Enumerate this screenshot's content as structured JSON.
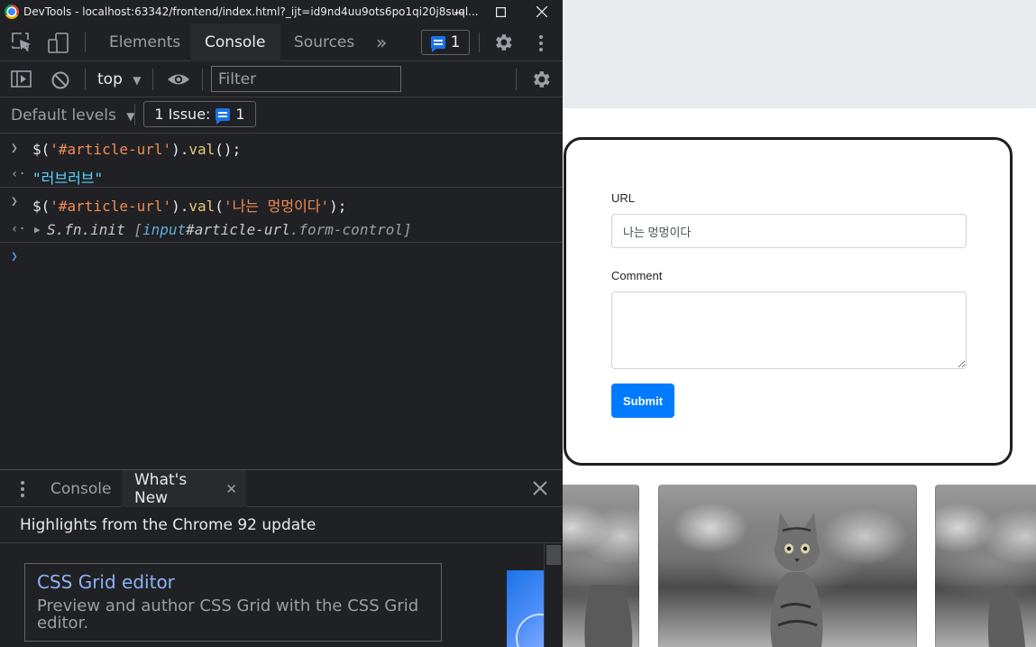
{
  "window": {
    "title": "DevTools - localhost:63342/frontend/index.html?_ijt=id9nd4uu9ots6po1qi20j8suql...",
    "minimize": "—",
    "maximize": "☐",
    "close": "✕"
  },
  "devtools": {
    "tabs": [
      "Elements",
      "Console",
      "Sources"
    ],
    "active_tab": "Console",
    "more_tabs": "»",
    "issues_count": "1",
    "context": "top",
    "filter_placeholder": "Filter",
    "levels": "Default levels",
    "issue_button": "1 Issue:",
    "issue_button_count": "1",
    "console_lines": [
      {
        "kind": "input",
        "code": "$('#article-url').val();"
      },
      {
        "kind": "result",
        "text": "\"러브러브\""
      },
      {
        "kind": "input",
        "code": "$('#article-url').val('나는 멍멍이다');"
      },
      {
        "kind": "result",
        "text": "S.fn.init [input#article-url.form-control]"
      }
    ],
    "drawer": {
      "tabs": [
        "Console",
        "What's New"
      ],
      "active_tab": "What's New",
      "header": "Highlights from the Chrome 92 update",
      "card_title": "CSS Grid editor",
      "card_desc": "Preview and author CSS Grid with the CSS Grid editor."
    }
  },
  "page": {
    "url_label": "URL",
    "url_value": "나는 멍멍이다",
    "comment_label": "Comment",
    "comment_value": "",
    "submit_label": "Submit"
  },
  "colors": {
    "devtools_bg": "#202124",
    "accent_blue": "#1a73e8",
    "submit_blue": "#007bff",
    "string_orange": "#f28b54"
  }
}
